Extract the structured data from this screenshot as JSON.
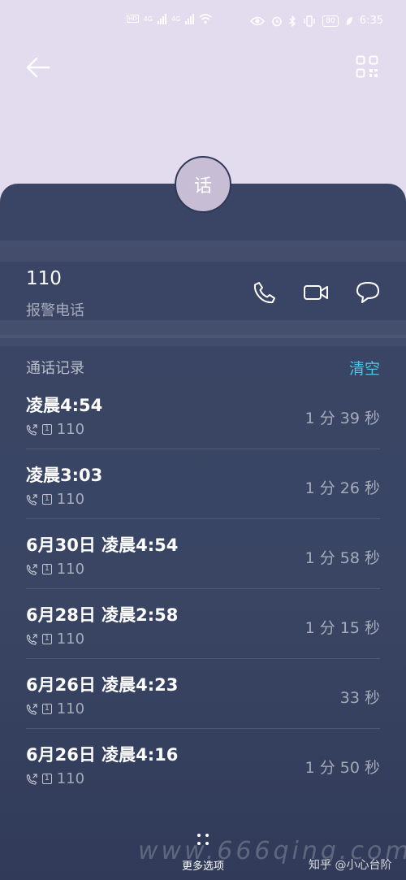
{
  "status_bar": {
    "net1": "4G",
    "net2": "4G",
    "hd": "HD",
    "battery": "80",
    "time": "6:35"
  },
  "contact": {
    "avatar_char": "话",
    "number": "110",
    "label": "报警电话"
  },
  "history": {
    "title": "通话记录",
    "clear_label": "清空",
    "calls": [
      {
        "time": "凌晨4:54",
        "sim": "1",
        "number": "110",
        "duration": "1 分 39 秒"
      },
      {
        "time": "凌晨3:03",
        "sim": "1",
        "number": "110",
        "duration": "1 分 26 秒"
      },
      {
        "time": "6月30日 凌晨4:54",
        "sim": "1",
        "number": "110",
        "duration": "1 分 58 秒"
      },
      {
        "time": "6月28日 凌晨2:58",
        "sim": "1",
        "number": "110",
        "duration": "1 分 15 秒"
      },
      {
        "time": "6月26日 凌晨4:23",
        "sim": "1",
        "number": "110",
        "duration": "33 秒"
      },
      {
        "time": "6月26日 凌晨4:16",
        "sim": "1",
        "number": "110",
        "duration": "1 分 50 秒"
      }
    ]
  },
  "bottom": {
    "more_label": "更多选项"
  },
  "watermark": {
    "text": "www.666qing.com",
    "credit": "知乎 @小心台阶"
  },
  "colors": {
    "top_bg": "#e3dcef",
    "card_bg": "#3a4566",
    "accent": "#4ec1e8",
    "avatar_bg": "#c7bdd4"
  }
}
